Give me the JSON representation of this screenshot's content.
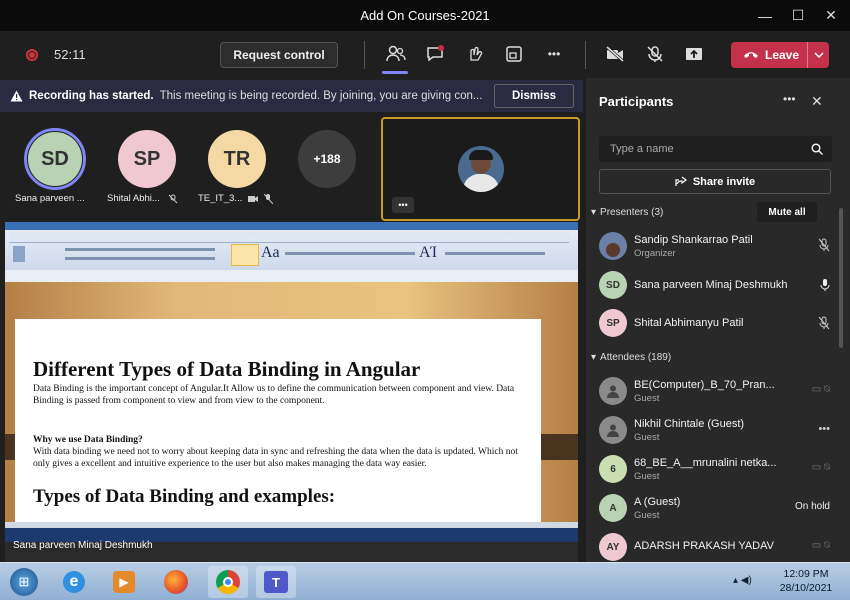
{
  "window": {
    "title": "Add On Courses-2021",
    "minimize": "—",
    "maximize": "☐",
    "close": "✕"
  },
  "toolbar": {
    "timer": "52:11",
    "request_control": "Request control",
    "more": "•••",
    "leave": "Leave"
  },
  "banner": {
    "title": "Recording has started.",
    "text": "This meeting is being recorded. By joining, you are giving con...",
    "dismiss": "Dismiss"
  },
  "stage": {
    "avatars": [
      {
        "initials": "SD",
        "name": "Sana parveen ...",
        "color": "#b9d2b4"
      },
      {
        "initials": "SP",
        "name": "Shital Abhi...",
        "color": "#f0c8d2"
      },
      {
        "initials": "TR",
        "name": "TE_IT_3...",
        "color": "#f4d9a4"
      },
      {
        "initials": "+188",
        "name": "",
        "color": "#3d3d3d"
      }
    ],
    "tile_more": "•••",
    "presenter_name": "Sana parveen Minaj Deshmukh"
  },
  "document": {
    "heading": "Different Types of Data Binding in Angular",
    "para1": "Data Binding is the important concept of Angular.It Allow us to define the communication between component and view. Data Binding is passed from component to view and from view to the component.",
    "subheading": "Why we use Data Binding?",
    "para2": "With data binding we need not to worry about keeping data in sync and refreshing the data when the data is updated. Which not only gives a excellent and intuitive experience to the user but also makes managing the data way easier.",
    "heading2": "Types of Data Binding and examples:"
  },
  "participants": {
    "title": "Participants",
    "search_placeholder": "Type a name",
    "share_invite": "Share invite",
    "presenters_label": "Presenters (3)",
    "mute_all": "Mute all",
    "attendees_label": "Attendees (189)",
    "presenters": [
      {
        "name": "Sandip Shankarrao Patil",
        "role": "Organizer",
        "initials": "",
        "color": "#6b7fa8"
      },
      {
        "name": "Sana parveen Minaj Deshmukh",
        "role": "",
        "initials": "SD",
        "color": "#b9d2b4"
      },
      {
        "name": "Shital Abhimanyu Patil",
        "role": "",
        "initials": "SP",
        "color": "#f0c8d2"
      }
    ],
    "attendees": [
      {
        "name": "BE(Computer)_B_70_Pran...",
        "role": "Guest",
        "initials": "",
        "color": "#8a8a8a",
        "status": ""
      },
      {
        "name": "Nikhil Chintale (Guest)",
        "role": "Guest",
        "initials": "",
        "color": "#8a8a8a",
        "status": "•••"
      },
      {
        "name": "68_BE_A__mrunalini netka...",
        "role": "Guest",
        "initials": "6",
        "color": "#c9dfb0",
        "status": ""
      },
      {
        "name": "A (Guest)",
        "role": "Guest",
        "initials": "A",
        "color": "#b9d2b4",
        "status": "On hold"
      },
      {
        "name": "ADARSH PRAKASH YADAV",
        "role": "",
        "initials": "AY",
        "color": "#f0c8d2",
        "status": ""
      }
    ]
  },
  "taskbar": {
    "time": "12:09 PM",
    "date": "28/10/2021"
  }
}
